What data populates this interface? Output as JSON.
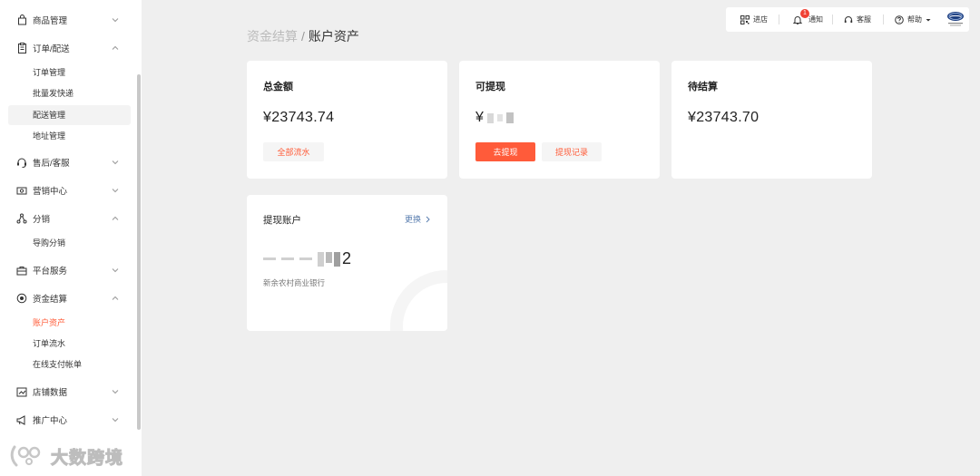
{
  "sidebar": {
    "groups": [
      {
        "label": "商品管理",
        "icon": "bag-icon",
        "expanded": false
      },
      {
        "label": "订单/配送",
        "icon": "clipboard-icon",
        "expanded": true,
        "items": [
          "订单管理",
          "批量发快递",
          "配送管理",
          "地址管理"
        ]
      },
      {
        "label": "售后/客服",
        "icon": "headset-icon",
        "expanded": false
      },
      {
        "label": "营销中心",
        "icon": "ticket-icon",
        "expanded": false
      },
      {
        "label": "分销",
        "icon": "share-nodes-icon",
        "expanded": true,
        "items": [
          "导购分销"
        ]
      },
      {
        "label": "平台服务",
        "icon": "briefcase-icon",
        "expanded": false
      },
      {
        "label": "资金结算",
        "icon": "coin-icon",
        "expanded": true,
        "items": [
          "账户资产",
          "订单流水",
          "在线支付帐单"
        ]
      },
      {
        "label": "店铺数据",
        "icon": "chart-icon",
        "expanded": false
      },
      {
        "label": "推广中心",
        "icon": "megaphone-icon",
        "expanded": false
      }
    ],
    "active_item": "账户资产",
    "highlighted_item": "配送管理"
  },
  "watermark": {
    "text": "大数跨境"
  },
  "breadcrumb": {
    "parent": "资金结算",
    "separator": "/",
    "current": "账户资产"
  },
  "toolbar": {
    "shop_label": "进店",
    "notify_label": "通知",
    "notify_count": "1",
    "service_label": "客服",
    "help_label": "帮助"
  },
  "cards": {
    "total": {
      "title": "总金额",
      "amount": "¥23743.74",
      "button": "全部流水"
    },
    "withdrawable": {
      "title": "可提现",
      "currency": "¥",
      "primary_button": "去提现",
      "secondary_button": "提现记录"
    },
    "pending": {
      "title": "待结算",
      "amount": "¥23743.70"
    },
    "account": {
      "title": "提现账户",
      "change_link": "更换",
      "number_suffix": "2",
      "bank": "新余农村商业银行"
    }
  },
  "colors": {
    "accent": "#ff5a36",
    "primary_button": "#ff5b3a",
    "link": "#5b7fb0",
    "badge": "#f04134"
  }
}
